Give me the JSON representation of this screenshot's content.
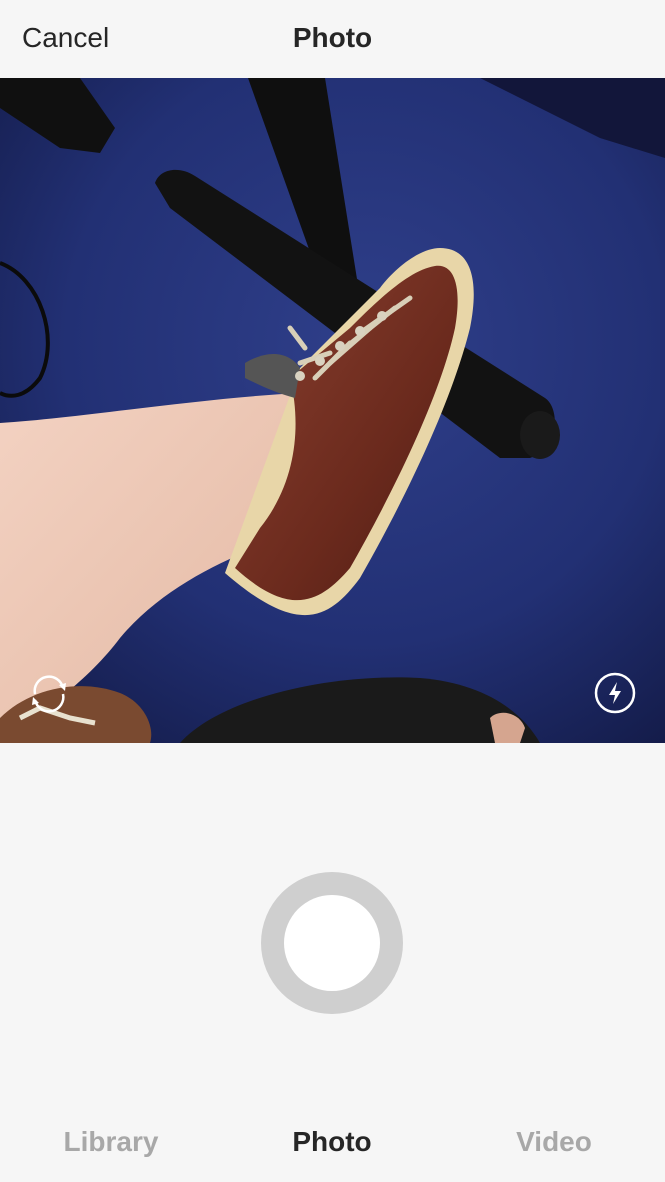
{
  "header": {
    "cancel_label": "Cancel",
    "title": "Photo"
  },
  "camera": {
    "flip_icon": "camera-flip-icon",
    "flash_icon": "flash-icon",
    "shutter_icon": "shutter-button"
  },
  "tabs": [
    {
      "label": "Library",
      "active": false
    },
    {
      "label": "Photo",
      "active": true
    },
    {
      "label": "Video",
      "active": false
    }
  ],
  "colors": {
    "background": "#f6f6f6",
    "text_primary": "#262626",
    "text_inactive": "#a8a8a8",
    "shutter_ring": "#cfcfcf"
  }
}
